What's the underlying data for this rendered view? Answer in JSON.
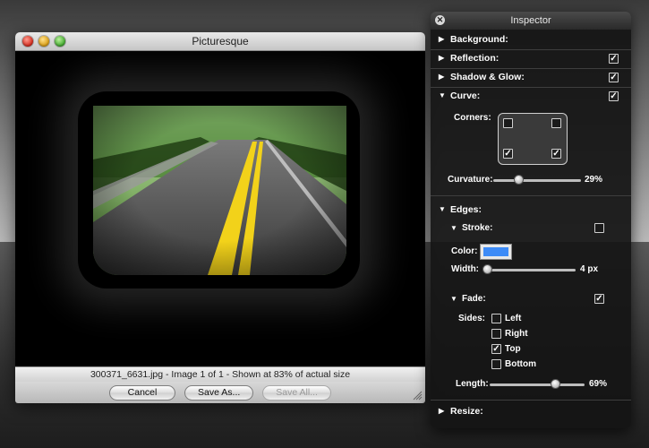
{
  "main_window": {
    "title": "Picturesque",
    "status_text": "300371_6631.jpg - Image 1 of 1 -  Shown at 83% of actual size",
    "buttons": {
      "cancel": "Cancel",
      "save_as": "Save As...",
      "save_all": "Save All..."
    }
  },
  "inspector": {
    "title": "Inspector",
    "close_glyph": "✕",
    "background": {
      "label": "Background:",
      "expanded": false
    },
    "reflection": {
      "label": "Reflection:",
      "expanded": false,
      "checked": true
    },
    "shadow_glow": {
      "label": "Shadow & Glow:",
      "expanded": false,
      "checked": true
    },
    "curve": {
      "label": "Curve:",
      "expanded": true,
      "checked": true,
      "corners_label": "Corners:",
      "corners": {
        "top_left": false,
        "top_right": false,
        "bottom_left": true,
        "bottom_right": true
      },
      "curvature_label": "Curvature:",
      "curvature_value": "29%",
      "curvature_fraction": 0.29
    },
    "edges": {
      "label": "Edges:",
      "expanded": true,
      "stroke": {
        "label": "Stroke:",
        "expanded": true,
        "checked": false,
        "color_label": "Color:",
        "color": "#3d8bf7",
        "width_label": "Width:",
        "width_value": "4 px",
        "width_fraction": 0.04
      },
      "fade": {
        "label": "Fade:",
        "expanded": true,
        "checked": true,
        "sides_label": "Sides:",
        "sides": [
          {
            "label": "Left",
            "checked": false
          },
          {
            "label": "Right",
            "checked": false
          },
          {
            "label": "Top",
            "checked": true
          },
          {
            "label": "Bottom",
            "checked": false
          }
        ],
        "length_label": "Length:",
        "length_value": "69%",
        "length_fraction": 0.69
      }
    },
    "resize": {
      "label": "Resize:",
      "expanded": false
    }
  },
  "glyphs": {
    "collapsed": "▶",
    "expanded": "▼",
    "check": "✓"
  },
  "colors": {
    "accent": "#3d8bf7",
    "hud_bg": "#141414"
  }
}
